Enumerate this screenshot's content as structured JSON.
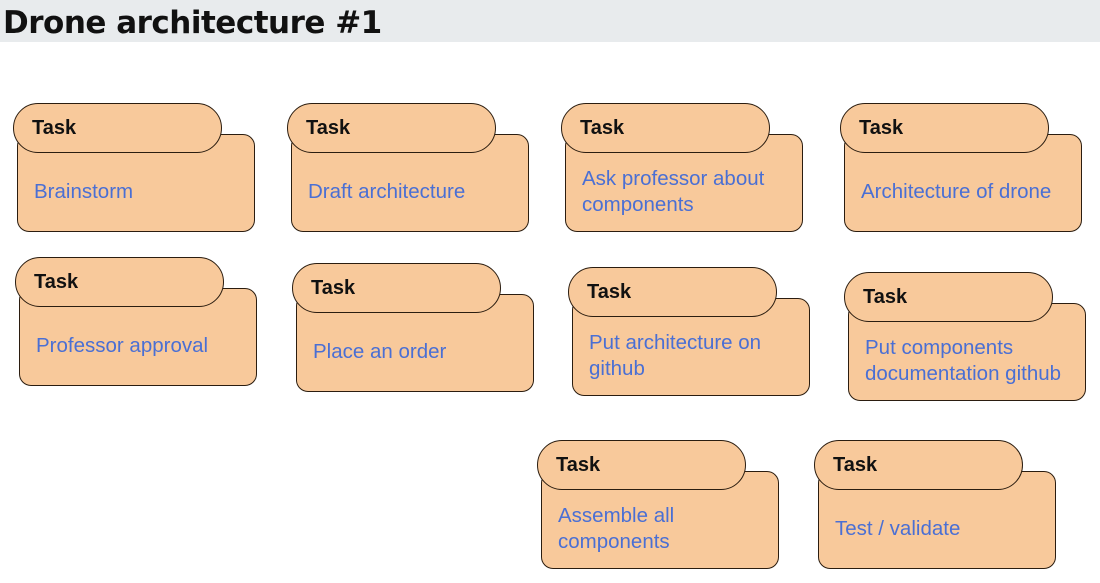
{
  "title": "Drone architecture #1",
  "colors": {
    "card_fill": "#f8c99b",
    "card_border": "#2b1d10",
    "task_text": "#4a6fd4",
    "title_bar": "#e8ebed"
  },
  "tasks": [
    {
      "tag": "Task",
      "name": "Brainstorm"
    },
    {
      "tag": "Task",
      "name": "Draft architecture"
    },
    {
      "tag": "Task",
      "name": "Ask professor about components"
    },
    {
      "tag": "Task",
      "name": "Architecture of drone"
    },
    {
      "tag": "Task",
      "name": "Professor approval"
    },
    {
      "tag": "Task",
      "name": "Place an order"
    },
    {
      "tag": "Task",
      "name": "Put architecture on github"
    },
    {
      "tag": "Task",
      "name": "Put components documentation github"
    },
    {
      "tag": "Task",
      "name": "Assemble all components"
    },
    {
      "tag": "Task",
      "name": "Test / validate"
    }
  ]
}
